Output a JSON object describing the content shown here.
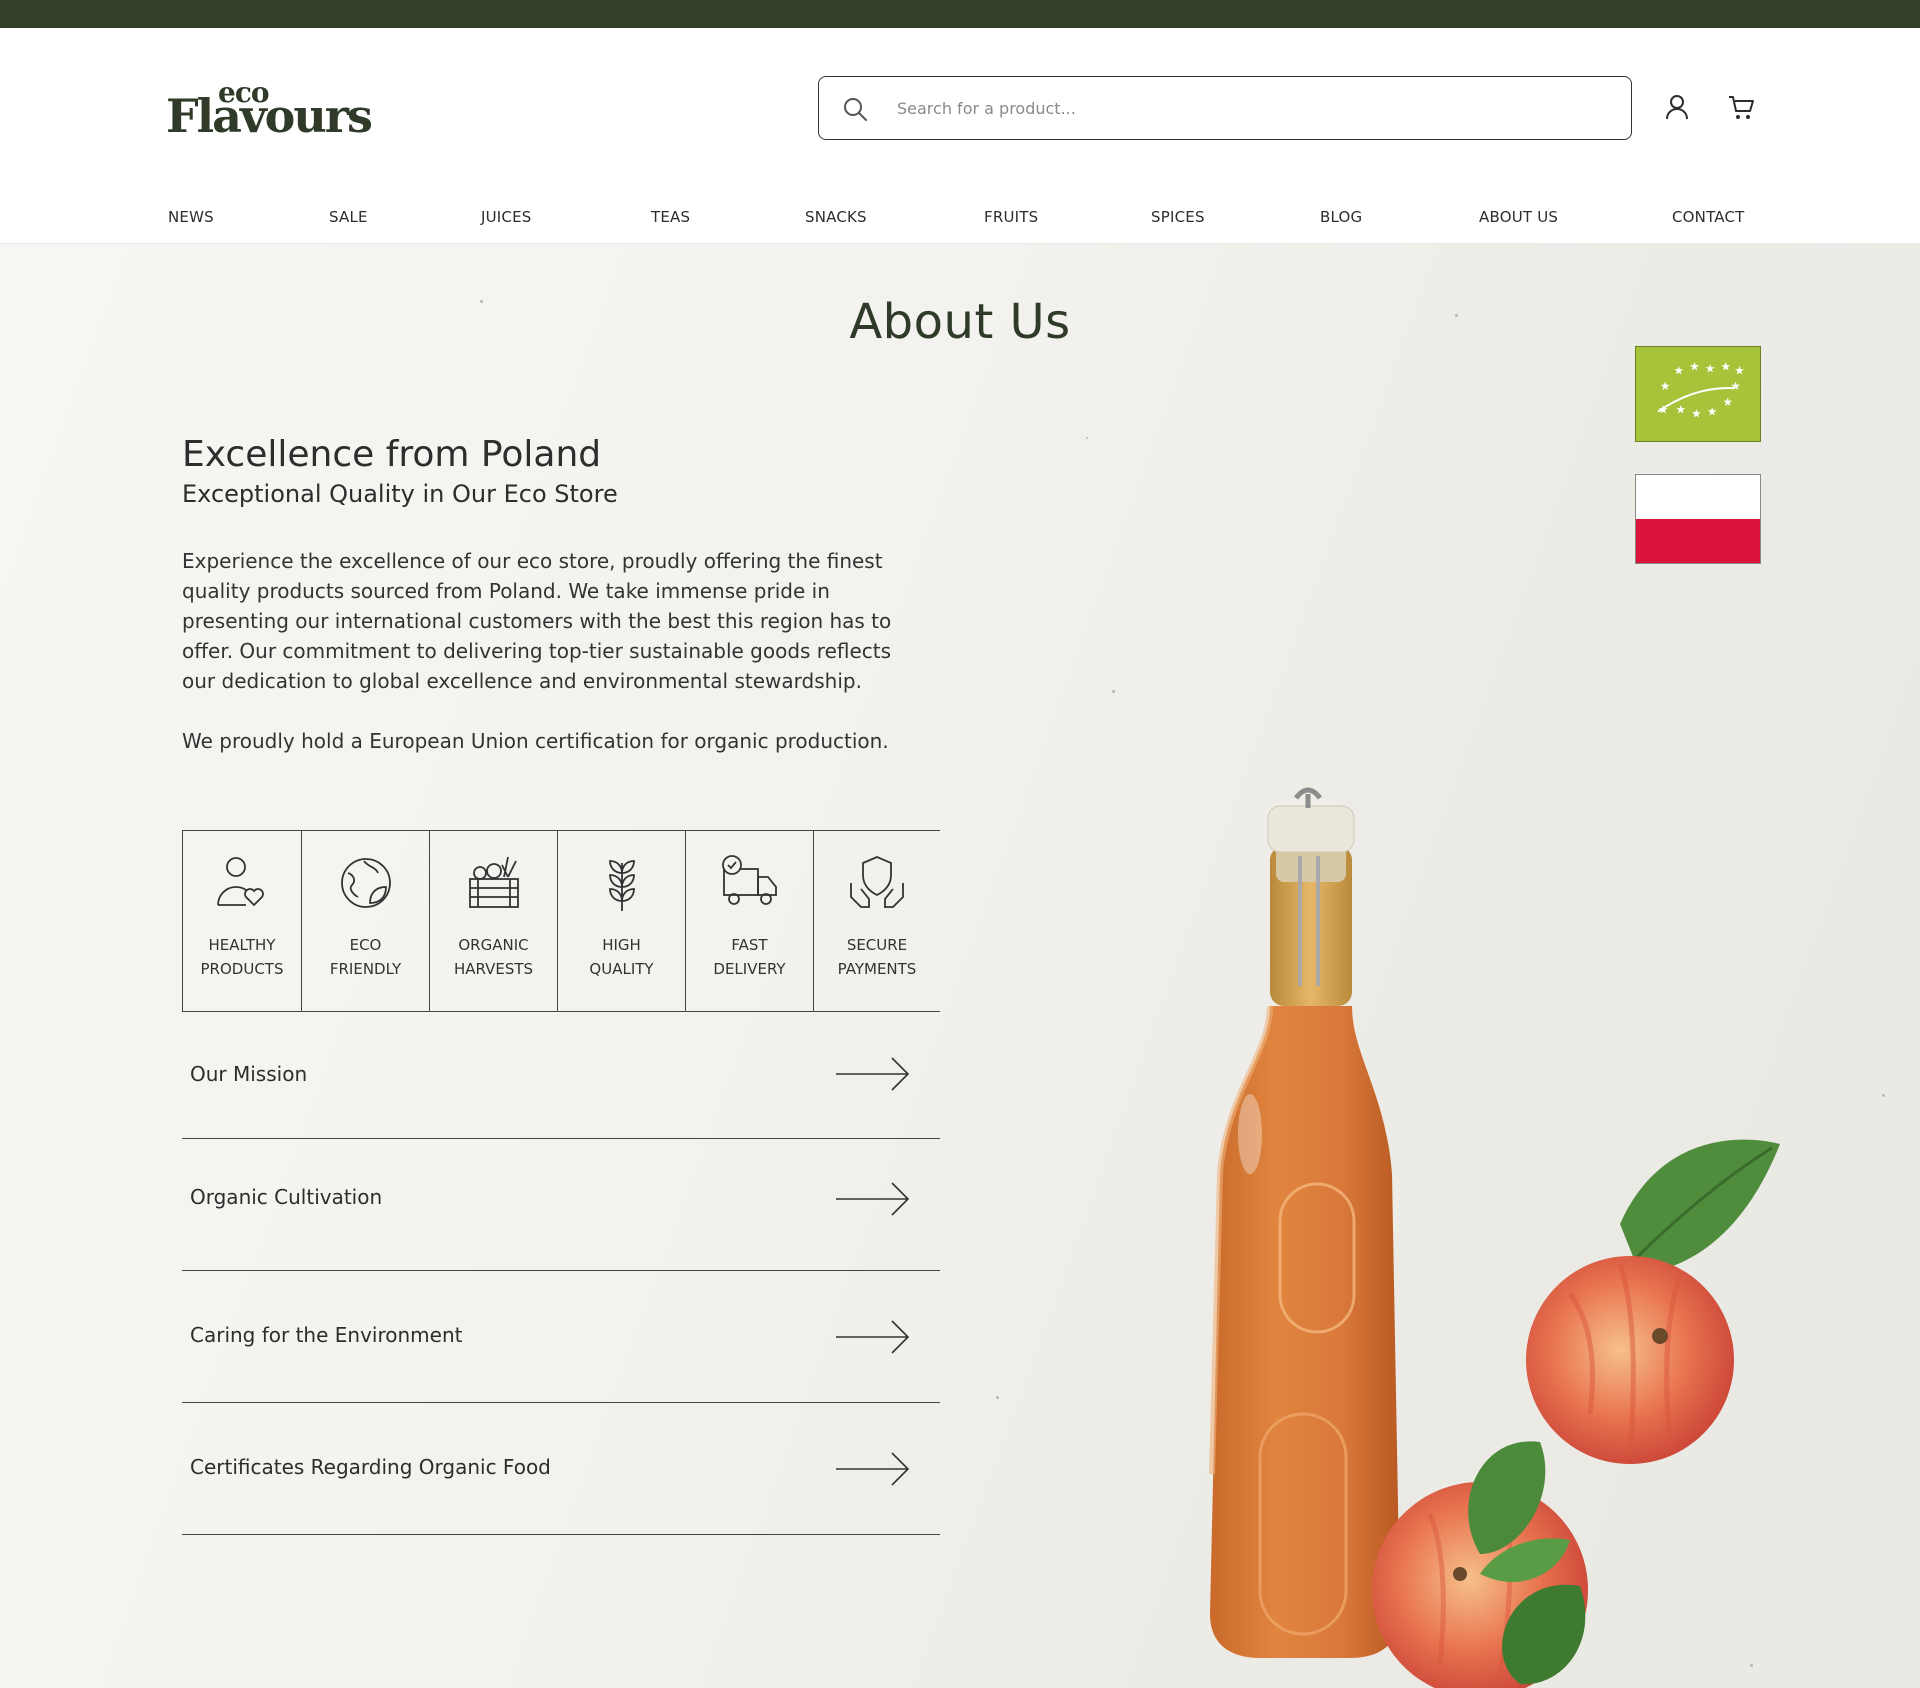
{
  "header": {
    "logo_top": "eco",
    "logo_main": "Flavours",
    "search_placeholder": "Search for a product...",
    "account_icon": "user-icon",
    "cart_icon": "cart-icon"
  },
  "nav": [
    "NEWS",
    "SALE",
    "JUICES",
    "TEAS",
    "SNACKS",
    "FRUITS",
    "SPICES",
    "BLOG",
    "ABOUT US",
    "CONTACT"
  ],
  "page": {
    "title": "About Us",
    "heading": "Excellence from Poland",
    "subheading": "Exceptional Quality in Our Eco Store",
    "paragraph1_lines": [
      "Experience the excellence of our eco store, proudly offering the finest",
      "quality products sourced from Poland. We take immense pride in",
      "presenting our international customers with the best this region has to",
      "offer. Our commitment to delivering top-tier sustainable goods reflects",
      "our dedication to global excellence and environmental stewardship."
    ],
    "paragraph2": "We proudly hold a European Union certification for organic production."
  },
  "badges": {
    "eu_icon": "eu-organic-leaf-icon",
    "flag_icon": "poland-flag-icon"
  },
  "features": [
    {
      "line1": "HEALTHY",
      "line2": "PRODUCTS",
      "icon": "person-heart-icon"
    },
    {
      "line1": "ECO",
      "line2": "FRIENDLY",
      "icon": "globe-leaf-icon"
    },
    {
      "line1": "ORGANIC",
      "line2": "HARVESTS",
      "icon": "crate-vegetables-icon"
    },
    {
      "line1": "HIGH",
      "line2": "QUALITY",
      "icon": "sprout-icon"
    },
    {
      "line1": "FAST",
      "line2": "DELIVERY",
      "icon": "truck-icon"
    },
    {
      "line1": "SECURE",
      "line2": "PAYMENTS",
      "icon": "shield-hands-icon"
    }
  ],
  "accordion": [
    {
      "label": "Our Mission",
      "icon": "arrow-right-icon"
    },
    {
      "label": "Organic Cultivation",
      "icon": "arrow-right-icon"
    },
    {
      "label": "Caring for the Environment",
      "icon": "arrow-right-icon"
    },
    {
      "label": "Certificates Regarding Organic Food",
      "icon": "arrow-right-icon"
    }
  ],
  "colors": {
    "topbar": "#33402b",
    "brand_dark": "#2f3a28",
    "eu_green": "#a6c33a",
    "flag_red": "#dc143c"
  }
}
